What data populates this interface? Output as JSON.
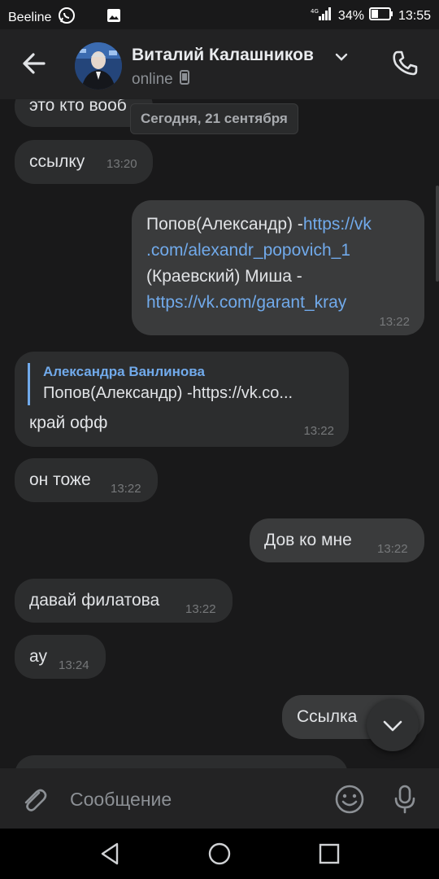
{
  "status_bar": {
    "carrier": "Beeline",
    "battery": "34%",
    "time": "13:55",
    "icons": [
      "whatsapp-icon",
      "image-icon",
      "signal-icon",
      "battery-icon"
    ]
  },
  "header": {
    "contact_name": "Виталий Калашников",
    "status": "online",
    "icons": [
      "back-arrow-icon",
      "chevron-down-icon",
      "mobile-icon",
      "phone-icon"
    ]
  },
  "chat": {
    "date_separator": "Сегодня, 21 сентября",
    "messages": [
      {
        "direction": "in",
        "text": "это кто вооб"
      },
      {
        "direction": "in",
        "text": "ссылку",
        "time": "13:20"
      },
      {
        "direction": "out",
        "line1_text": "Попов(Александр) -",
        "line1_link": "https://vk",
        "line2_link": ".com/alexandr_popovich_1",
        "line3_text": "(Краевский) Миша -",
        "line4_link": "https://vk.com/garant_kray",
        "time": "13:22"
      },
      {
        "direction": "in",
        "reply_author": "Александра Ванлинова",
        "reply_text": "Попов(Александр) -https://vk.co...",
        "text": "край офф",
        "time": "13:22"
      },
      {
        "direction": "in",
        "text": "он тоже",
        "time": "13:22"
      },
      {
        "direction": "out",
        "text": "Дов ко мне",
        "time": "13:22"
      },
      {
        "direction": "in",
        "text": "давай филатова",
        "time": "13:22"
      },
      {
        "direction": "in",
        "text": "ау",
        "time": "13:24"
      },
      {
        "direction": "out",
        "text": "Ссылка"
      }
    ]
  },
  "composer": {
    "placeholder": "Сообщение",
    "icons": [
      "paperclip-icon",
      "emoji-icon",
      "microphone-icon"
    ]
  },
  "scroll_down_icon": "chevron-down-icon",
  "colors": {
    "background": "#19191a",
    "incoming_bubble": "#2c2d2e",
    "outgoing_bubble": "#3a3b3c",
    "link": "#71aaeb",
    "reply_accent": "#71aaeb"
  }
}
